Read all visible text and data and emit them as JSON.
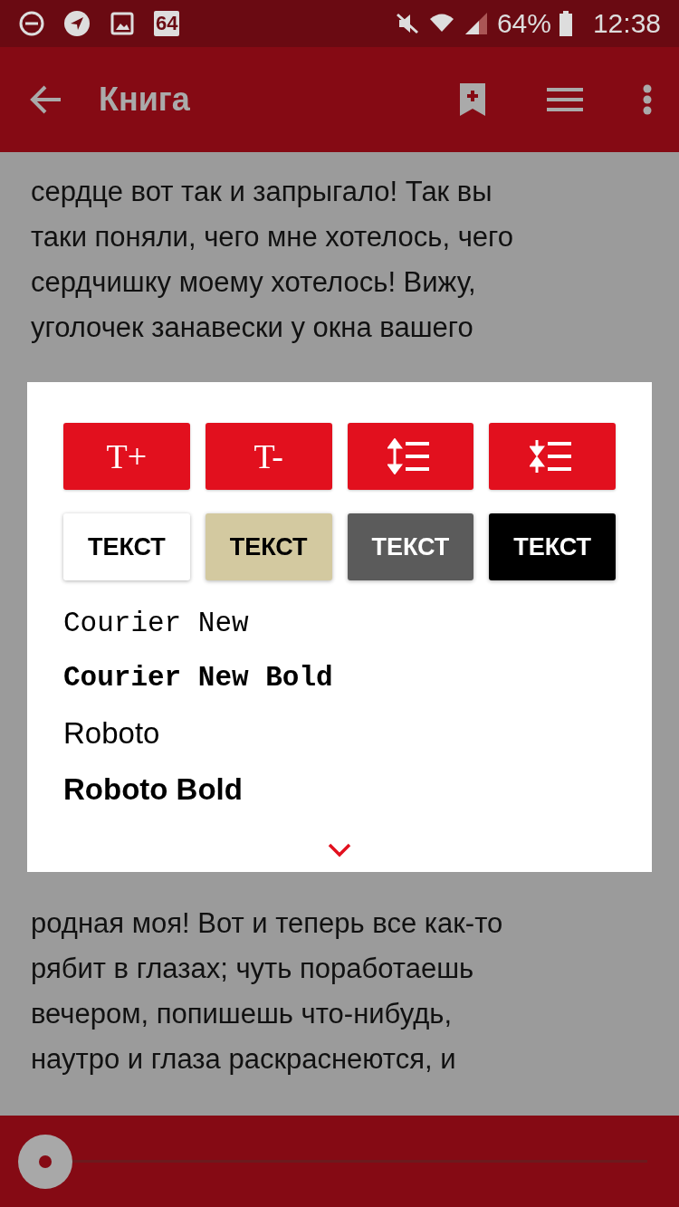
{
  "status_bar": {
    "calendar_day": "64",
    "battery_text": "64%",
    "time": "12:38"
  },
  "app_bar": {
    "title": "Книга"
  },
  "page_lines_top": [
    "сердце вот так и запрыгало! Так вы",
    "таки поняли, чего мне хотелось, чего",
    "сердчишку моему хотелось! Вижу,",
    "уголочек занавески у окна вашего"
  ],
  "page_lines_bottom": [
    "родная моя! Вот и теперь все как-то",
    "рябит в глазах; чуть поработаешь",
    "вечером, попишешь что-нибудь,",
    "наутро и глаза раскраснеются, и"
  ],
  "settings_dialog": {
    "size_buttons": [
      {
        "kind": "font-up",
        "label": "T+"
      },
      {
        "kind": "font-down",
        "label": "T-"
      },
      {
        "kind": "spacing-up"
      },
      {
        "kind": "spacing-down"
      }
    ],
    "themes": [
      {
        "label": "ТЕКСТ",
        "color": "#ffffff"
      },
      {
        "label": "ТЕКСТ",
        "color": "#d3c9a0"
      },
      {
        "label": "ТЕКСТ",
        "color": "#5b5b5b"
      },
      {
        "label": "ТЕКСТ",
        "color": "#000000"
      }
    ],
    "fonts": [
      {
        "label": "Courier New",
        "kind": "mono",
        "bold": false
      },
      {
        "label": "Courier New Bold",
        "kind": "mono",
        "bold": true
      },
      {
        "label": "Roboto",
        "kind": "sans",
        "bold": false
      },
      {
        "label": "Roboto Bold",
        "kind": "sans",
        "bold": true
      }
    ]
  },
  "progress": {
    "level": 0
  }
}
